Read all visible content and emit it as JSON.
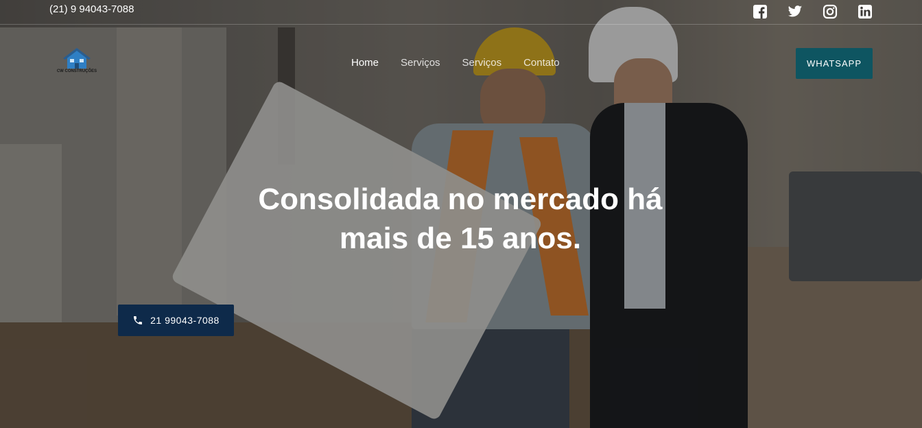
{
  "topbar": {
    "phone": "(21) 9 94043-7088",
    "socials": [
      "facebook-icon",
      "twitter-icon",
      "instagram-icon",
      "linkedin-icon"
    ]
  },
  "logo": {
    "text": "CW CONSTRUÇÕES"
  },
  "nav": {
    "items": [
      {
        "label": "Home",
        "active": true
      },
      {
        "label": "Serviços",
        "active": false
      },
      {
        "label": "Serviços",
        "active": false
      },
      {
        "label": "Contato",
        "active": false
      }
    ]
  },
  "header": {
    "cta_label": "WHATSAPP"
  },
  "hero": {
    "headline_line1": "Consolidada no mercado há",
    "headline_line2": "mais de 15 anos.",
    "call_label": "21 99043-7088"
  },
  "colors": {
    "whatsapp_button": "#0e5561",
    "call_button": "#0e2a4a"
  }
}
